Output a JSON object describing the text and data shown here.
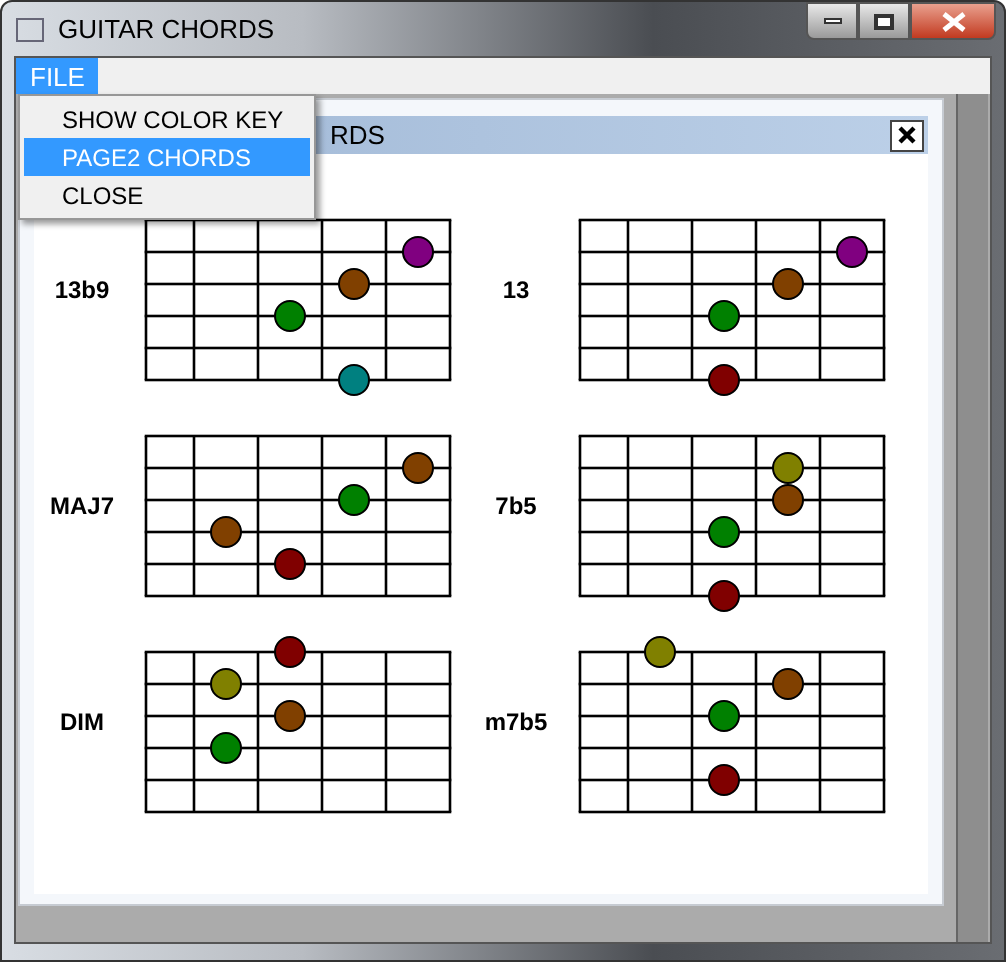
{
  "window": {
    "title": "GUITAR CHORDS"
  },
  "menu_bar": [
    {
      "label": "FILE",
      "selected": true
    }
  ],
  "menu": [
    {
      "label": "SHOW COLOR KEY",
      "selected": false
    },
    {
      "label": "PAGE2 CHORDS",
      "selected": true
    },
    {
      "label": "CLOSE",
      "selected": false
    }
  ],
  "child_window": {
    "title": "RDS"
  },
  "chords": [
    {
      "name": "13b9",
      "strings": [
        {
          "frets": [
            {
              "dot": false
            },
            {
              "dot": false
            },
            {
              "dot": false
            },
            {
              "dot": false
            },
            {
              "dot": false
            }
          ]
        },
        {
          "frets": [
            {
              "dot": false
            },
            {
              "dot": false
            },
            {
              "dot": false
            },
            {
              "dot": false
            },
            {
              "dot": true,
              "color": "#800080"
            }
          ]
        },
        {
          "frets": [
            {
              "dot": false
            },
            {
              "dot": false
            },
            {
              "dot": false
            },
            {
              "dot": true,
              "color": "#804000"
            },
            {
              "dot": false
            }
          ]
        },
        {
          "frets": [
            {
              "dot": false
            },
            {
              "dot": false
            },
            {
              "dot": true,
              "color": "#008000"
            },
            {
              "dot": false
            },
            {
              "dot": false
            }
          ]
        },
        {
          "frets": [
            {
              "dot": false
            },
            {
              "dot": false
            },
            {
              "dot": false
            },
            {
              "dot": false
            },
            {
              "dot": false
            }
          ]
        },
        {
          "frets": [
            {
              "dot": false
            },
            {
              "dot": false
            },
            {
              "dot": false
            },
            {
              "dot": true,
              "color": "#008080"
            },
            {
              "dot": false
            }
          ]
        }
      ]
    },
    {
      "name": "13",
      "strings": [
        {
          "frets": [
            {
              "dot": false
            },
            {
              "dot": false
            },
            {
              "dot": false
            },
            {
              "dot": false
            },
            {
              "dot": false
            }
          ]
        },
        {
          "frets": [
            {
              "dot": false
            },
            {
              "dot": false
            },
            {
              "dot": false
            },
            {
              "dot": false
            },
            {
              "dot": true,
              "color": "#800080"
            }
          ]
        },
        {
          "frets": [
            {
              "dot": false
            },
            {
              "dot": false
            },
            {
              "dot": false
            },
            {
              "dot": true,
              "color": "#804000"
            },
            {
              "dot": false
            }
          ]
        },
        {
          "frets": [
            {
              "dot": false
            },
            {
              "dot": false
            },
            {
              "dot": true,
              "color": "#008000"
            },
            {
              "dot": false
            },
            {
              "dot": false
            }
          ]
        },
        {
          "frets": [
            {
              "dot": false
            },
            {
              "dot": false
            },
            {
              "dot": false
            },
            {
              "dot": false
            },
            {
              "dot": false
            }
          ]
        },
        {
          "frets": [
            {
              "dot": false
            },
            {
              "dot": false
            },
            {
              "dot": true,
              "color": "#800000"
            },
            {
              "dot": false
            },
            {
              "dot": false
            }
          ]
        }
      ]
    },
    {
      "name": "MAJ7",
      "strings": [
        {
          "frets": [
            {
              "dot": false
            },
            {
              "dot": false
            },
            {
              "dot": false
            },
            {
              "dot": false
            },
            {
              "dot": false
            }
          ]
        },
        {
          "frets": [
            {
              "dot": false
            },
            {
              "dot": false
            },
            {
              "dot": false
            },
            {
              "dot": false
            },
            {
              "dot": true,
              "color": "#804000"
            }
          ]
        },
        {
          "frets": [
            {
              "dot": false
            },
            {
              "dot": false
            },
            {
              "dot": false
            },
            {
              "dot": true,
              "color": "#008000"
            },
            {
              "dot": false
            }
          ]
        },
        {
          "frets": [
            {
              "dot": false
            },
            {
              "dot": true,
              "color": "#804000"
            },
            {
              "dot": false
            },
            {
              "dot": false
            },
            {
              "dot": false
            }
          ]
        },
        {
          "frets": [
            {
              "dot": false
            },
            {
              "dot": false
            },
            {
              "dot": true,
              "color": "#800000"
            },
            {
              "dot": false
            },
            {
              "dot": false
            }
          ]
        },
        {
          "frets": [
            {
              "dot": false
            },
            {
              "dot": false
            },
            {
              "dot": false
            },
            {
              "dot": false
            },
            {
              "dot": false
            }
          ]
        }
      ]
    },
    {
      "name": "7b5",
      "strings": [
        {
          "frets": [
            {
              "dot": false
            },
            {
              "dot": false
            },
            {
              "dot": false
            },
            {
              "dot": false
            },
            {
              "dot": false
            }
          ]
        },
        {
          "frets": [
            {
              "dot": false
            },
            {
              "dot": false
            },
            {
              "dot": false
            },
            {
              "dot": true,
              "color": "#808000"
            },
            {
              "dot": false
            }
          ]
        },
        {
          "frets": [
            {
              "dot": false
            },
            {
              "dot": false
            },
            {
              "dot": false
            },
            {
              "dot": true,
              "color": "#804000"
            },
            {
              "dot": false
            }
          ]
        },
        {
          "frets": [
            {
              "dot": false
            },
            {
              "dot": false
            },
            {
              "dot": true,
              "color": "#008000"
            },
            {
              "dot": false
            },
            {
              "dot": false
            }
          ]
        },
        {
          "frets": [
            {
              "dot": false
            },
            {
              "dot": false
            },
            {
              "dot": false
            },
            {
              "dot": false
            },
            {
              "dot": false
            }
          ]
        },
        {
          "frets": [
            {
              "dot": false
            },
            {
              "dot": false
            },
            {
              "dot": true,
              "color": "#800000"
            },
            {
              "dot": false
            },
            {
              "dot": false
            }
          ]
        }
      ]
    },
    {
      "name": "DIM",
      "strings": [
        {
          "frets": [
            {
              "dot": false
            },
            {
              "dot": false
            },
            {
              "dot": true,
              "color": "#800000"
            },
            {
              "dot": false
            },
            {
              "dot": false
            }
          ]
        },
        {
          "frets": [
            {
              "dot": false
            },
            {
              "dot": true,
              "color": "#808000"
            },
            {
              "dot": false
            },
            {
              "dot": false
            },
            {
              "dot": false
            }
          ]
        },
        {
          "frets": [
            {
              "dot": false
            },
            {
              "dot": false
            },
            {
              "dot": true,
              "color": "#804000"
            },
            {
              "dot": false
            },
            {
              "dot": false
            }
          ]
        },
        {
          "frets": [
            {
              "dot": false
            },
            {
              "dot": true,
              "color": "#008000"
            },
            {
              "dot": false
            },
            {
              "dot": false
            },
            {
              "dot": false
            }
          ]
        },
        {
          "frets": [
            {
              "dot": false
            },
            {
              "dot": false
            },
            {
              "dot": false
            },
            {
              "dot": false
            },
            {
              "dot": false
            }
          ]
        },
        {
          "frets": [
            {
              "dot": false
            },
            {
              "dot": false
            },
            {
              "dot": false
            },
            {
              "dot": false
            },
            {
              "dot": false
            }
          ]
        }
      ]
    },
    {
      "name": "m7b5",
      "strings": [
        {
          "frets": [
            {
              "dot": false
            },
            {
              "dot": true,
              "color": "#808000"
            },
            {
              "dot": false
            },
            {
              "dot": false
            },
            {
              "dot": false
            }
          ]
        },
        {
          "frets": [
            {
              "dot": false
            },
            {
              "dot": false
            },
            {
              "dot": false
            },
            {
              "dot": true,
              "color": "#804000"
            },
            {
              "dot": false
            }
          ]
        },
        {
          "frets": [
            {
              "dot": false
            },
            {
              "dot": false
            },
            {
              "dot": true,
              "color": "#008000"
            },
            {
              "dot": false
            },
            {
              "dot": false
            }
          ]
        },
        {
          "frets": [
            {
              "dot": false
            },
            {
              "dot": false
            },
            {
              "dot": false
            },
            {
              "dot": false
            },
            {
              "dot": false
            }
          ]
        },
        {
          "frets": [
            {
              "dot": false
            },
            {
              "dot": false
            },
            {
              "dot": true,
              "color": "#800000"
            },
            {
              "dot": false
            },
            {
              "dot": false
            }
          ]
        },
        {
          "frets": [
            {
              "dot": false
            },
            {
              "dot": false
            },
            {
              "dot": false
            },
            {
              "dot": false
            },
            {
              "dot": false
            }
          ]
        }
      ]
    }
  ]
}
